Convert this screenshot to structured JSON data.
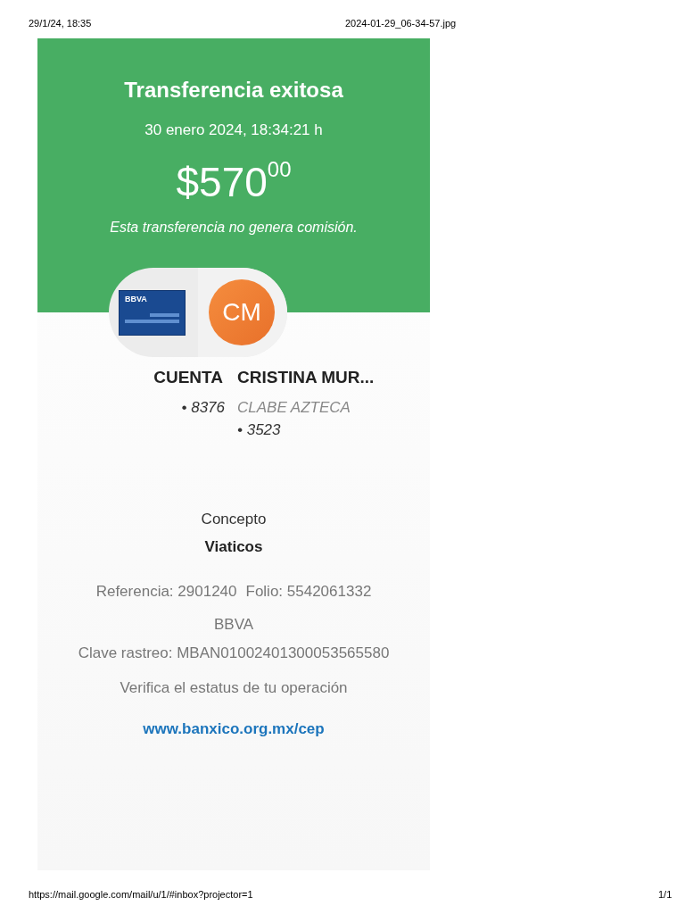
{
  "page_header": {
    "date": "29/1/24, 18:35",
    "file": "2024-01-29_06-34-57.jpg"
  },
  "receipt": {
    "title": "Transferencia exitosa",
    "datetime": "30 enero 2024, 18:34:21 h",
    "amount": "$570$^{00}$",
    "note": "Esta transferencia no genera comisión.",
    "origin": {
      "card_brand": "BBVA",
      "name": "CUENTA",
      "account": "• 8376"
    },
    "destination": {
      "initials": "CM",
      "name": "CRISTINA MUR...",
      "bank": "CLABE AZTECA",
      "account": "• 3523"
    },
    "concept_label": "Concepto",
    "concept": "Viaticos",
    "reference": "Referencia: 2901240",
    "folio": "Folio: 5542061332",
    "bank": "BBVA",
    "tracking": "Clave rastreo: MBAN01002401300053565580",
    "verify_text": "Verifica el estatus de tu operación",
    "link": "www.banxico.org.mx/cep"
  },
  "page_footer": {
    "url": "https://mail.google.com/mail/u/1/#inbox?projector=1",
    "page": "1/1"
  }
}
